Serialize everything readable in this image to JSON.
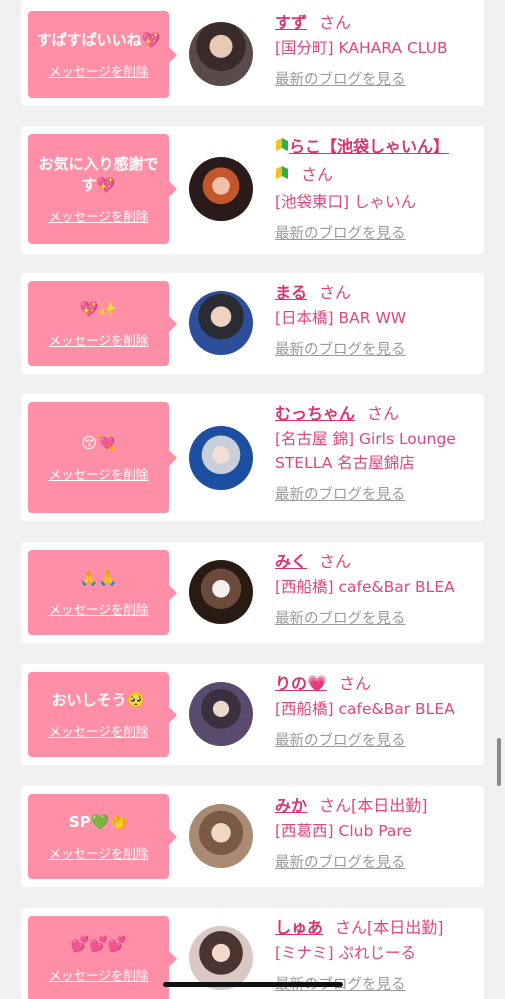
{
  "entries": [
    {
      "message": "すぱすぱいいね💖",
      "delete_label": "メッセージを削除",
      "name": "すず",
      "san": "さん",
      "status": "",
      "shop_lines": [
        "[国分町] KAHARA CLUB"
      ],
      "blog_label": "最新のブログを見る",
      "beginner": false
    },
    {
      "message": "お気に入り感謝です💖",
      "delete_label": "メッセージを削除",
      "name": "らこ【池袋しゃいん】",
      "san": "さん",
      "status": "",
      "shop_lines": [
        "[池袋東口] しゃいん"
      ],
      "blog_label": "最新のブログを見る",
      "beginner": true
    },
    {
      "message": "💖✨",
      "delete_label": "メッセージを削除",
      "name": "まる",
      "san": "さん",
      "status": "",
      "shop_lines": [
        "[日本橋] BAR WW"
      ],
      "blog_label": "最新のブログを見る",
      "beginner": false
    },
    {
      "message": "😚💘",
      "delete_label": "メッセージを削除",
      "name": "むっちゃん",
      "san": "さん",
      "status": "",
      "shop_lines": [
        "[名古屋 錦] Girls Lounge",
        "STELLA 名古屋錦店"
      ],
      "blog_label": "最新のブログを見る",
      "beginner": false
    },
    {
      "message": "🙏🙏",
      "delete_label": "メッセージを削除",
      "name": "みく",
      "san": "さん",
      "status": "",
      "shop_lines": [
        "[西船橋] cafe&Bar BLEA"
      ],
      "blog_label": "最新のブログを見る",
      "beginner": false
    },
    {
      "message": "おいしそう🥺",
      "delete_label": "メッセージを削除",
      "name": "りの💗",
      "san": "さん",
      "status": "",
      "shop_lines": [
        "[西船橋] cafe&Bar BLEA"
      ],
      "blog_label": "最新のブログを見る",
      "beginner": false
    },
    {
      "message": "SP💚👏",
      "delete_label": "メッセージを削除",
      "name": "みか",
      "san": "さん",
      "status": "[本日出勤]",
      "shop_lines": [
        "[西葛西] Club Pare"
      ],
      "blog_label": "最新のブログを見る",
      "beginner": false
    },
    {
      "message": "💕💕💕",
      "delete_label": "メッセージを削除",
      "name": "しゅあ",
      "san": "さん",
      "status": "[本日出勤]",
      "shop_lines": [
        "[ミナミ] ぷれじーる"
      ],
      "blog_label": "最新のブログを見る",
      "beginner": false
    }
  ],
  "colors": {
    "bubble": "#ff8fa6",
    "name": "#d8336a",
    "shop_text": "#e0457d",
    "blog_link": "#9a9a9a",
    "background": "#f1f1f1"
  },
  "icons": {
    "avatar": "avatar-photo",
    "beginner_mark": "beginner-leaf-icon"
  }
}
